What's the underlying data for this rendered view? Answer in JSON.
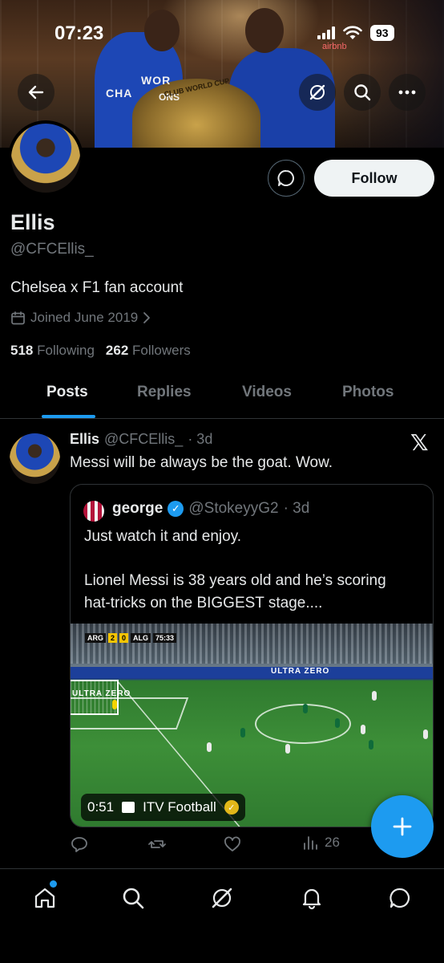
{
  "status_bar": {
    "time": "07:23",
    "battery": "93"
  },
  "profile": {
    "display_name": "Ellis",
    "handle": "@CFCEllis_",
    "bio": "Chelsea x F1 fan account",
    "joined": "Joined June 2019",
    "following_count": "518",
    "following_label": "Following",
    "followers_count": "262",
    "followers_label": "Followers",
    "follow_button": "Follow"
  },
  "banner": {
    "shirt_text_1": "WOR",
    "shirt_text_2": "CHA",
    "shirt_text_3": "ONS",
    "trophy_text": "CLUB WORLD CUP",
    "sponsor_text": "airbnb"
  },
  "tabs": [
    {
      "label": "Posts",
      "active": true
    },
    {
      "label": "Replies",
      "active": false
    },
    {
      "label": "Videos",
      "active": false
    },
    {
      "label": "Photos",
      "active": false
    }
  ],
  "post": {
    "author": "Ellis",
    "handle": "@CFCEllis_",
    "time": "· 3d",
    "text": "Messi will be always be the goat. Wow.",
    "quote": {
      "author": "george",
      "handle": "@StokeyyG2",
      "time": "· 3d",
      "lines": [
        "Just watch it and enjoy.",
        "Lionel Messi is 38 years old and he’s scoring",
        "hat-tricks on the BIGGEST stage...."
      ],
      "video": {
        "duration": "0:51",
        "source": "ITV Football",
        "score_home": "ARG",
        "score_home_goals": "2",
        "score_away_goals": "0",
        "score_away": "ALG",
        "match_clock": "75:33",
        "ad_text": "ULTRA ZERO",
        "goal_ad_text": "ULTRA ZERO"
      }
    },
    "views": "26"
  },
  "icons": {
    "back": "back-arrow-icon",
    "grok": "grok-icon",
    "search": "search-icon",
    "more": "more-icon",
    "message": "message-icon",
    "calendar": "calendar-icon",
    "x_logo": "x-logo-icon",
    "verified": "verified-badge-icon",
    "reply": "reply-icon",
    "repost": "repost-icon",
    "like": "like-icon",
    "views": "views-icon",
    "compose": "compose-plus-icon",
    "home": "home-icon",
    "notifications": "bell-icon",
    "messages": "messages-icon"
  },
  "colors": {
    "accent": "#1d9bf0",
    "muted": "#71767b",
    "background": "#000000",
    "text": "#e7e9ea"
  }
}
